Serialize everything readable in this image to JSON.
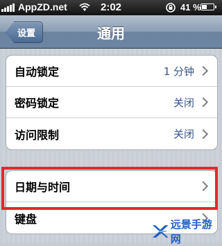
{
  "status_bar": {
    "carrier": "AppZD.net",
    "time": "2:02",
    "battery_percent": "41 %",
    "battery_level": 0.41
  },
  "nav": {
    "back_label": "设置",
    "title": "通用"
  },
  "settings_group_1": [
    {
      "label": "自动锁定",
      "value": "1 分钟"
    },
    {
      "label": "密码锁定",
      "value": "关闭"
    },
    {
      "label": "访问限制",
      "value": "关闭"
    }
  ],
  "settings_group_2": [
    {
      "label": "日期与时间",
      "value": ""
    },
    {
      "label": "键盘",
      "value": ""
    }
  ],
  "watermark": {
    "text": "远景手游网"
  },
  "colors": {
    "highlight": "#e8262b",
    "value_text": "#385487",
    "watermark": "#1f5fc8"
  }
}
